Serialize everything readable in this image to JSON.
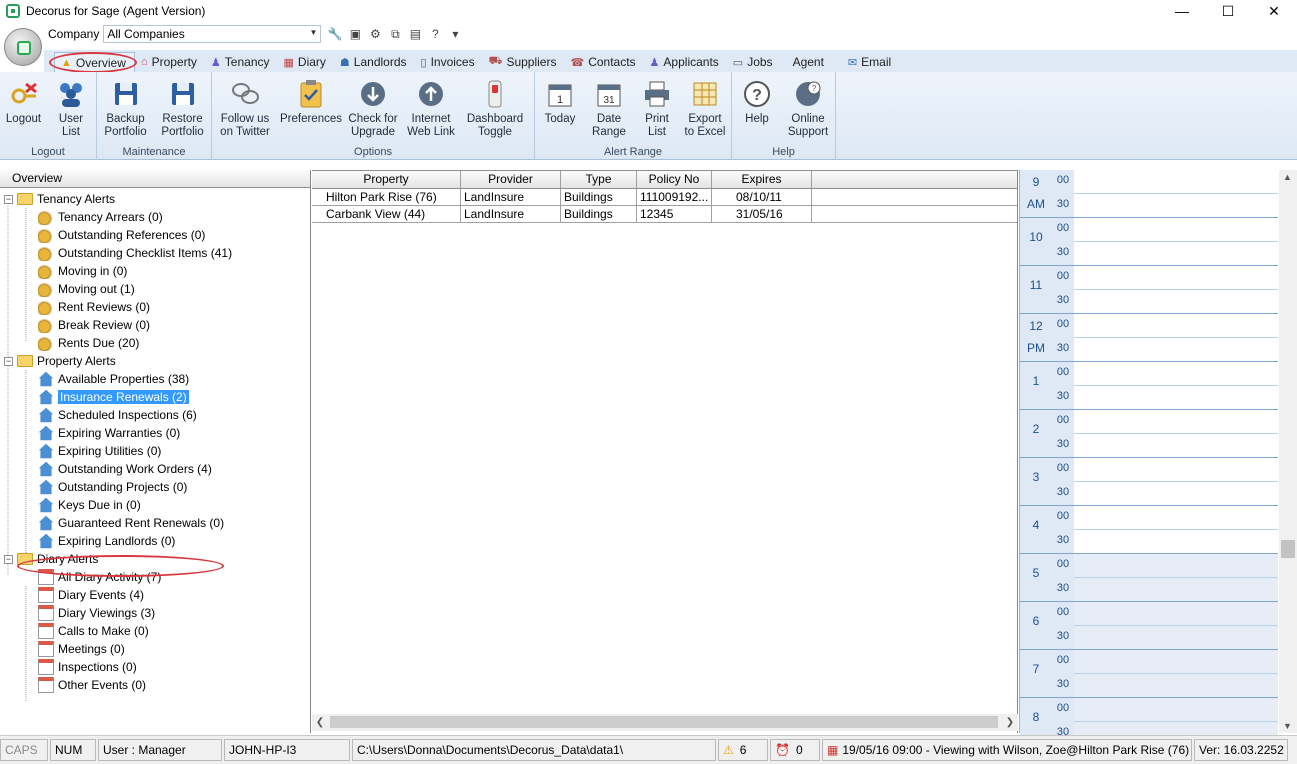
{
  "window": {
    "title": "Decorus for Sage (Agent Version)",
    "minimize": "—",
    "maximize": "☐",
    "close": "✕"
  },
  "company": {
    "label": "Company",
    "value": "All Companies"
  },
  "tabs": [
    {
      "label": "Overview",
      "icon": "overview-icon"
    },
    {
      "label": "Property",
      "icon": "property-icon"
    },
    {
      "label": "Tenancy",
      "icon": "tenancy-icon"
    },
    {
      "label": "Diary",
      "icon": "diary-icon"
    },
    {
      "label": "Landlords",
      "icon": "landlords-icon"
    },
    {
      "label": "Invoices",
      "icon": "invoices-icon"
    },
    {
      "label": "Suppliers",
      "icon": "suppliers-icon"
    },
    {
      "label": "Contacts",
      "icon": "contacts-icon"
    },
    {
      "label": "Applicants",
      "icon": "applicants-icon"
    },
    {
      "label": "Jobs",
      "icon": "jobs-icon"
    },
    {
      "label": "Agent",
      "icon": ""
    },
    {
      "label": "Email",
      "icon": "email-icon"
    }
  ],
  "ribbon": {
    "logout": {
      "group": "Logout",
      "logout": "Logout",
      "user_list_1": "User",
      "user_list_2": "List"
    },
    "maintenance": {
      "group": "Maintenance",
      "backup_1": "Backup",
      "backup_2": "Portfolio",
      "restore_1": "Restore",
      "restore_2": "Portfolio"
    },
    "options": {
      "group": "Options",
      "twitter_1": "Follow us",
      "twitter_2": "on Twitter",
      "preferences": "Preferences",
      "upgrade_1": "Check for",
      "upgrade_2": "Upgrade",
      "weblink_1": "Internet",
      "weblink_2": "Web Link",
      "dash_1": "Dashboard",
      "dash_2": "Toggle"
    },
    "alert_range": {
      "group": "Alert Range",
      "today": "Today",
      "date_1": "Date",
      "date_2": "Range",
      "print_1": "Print",
      "print_2": "List",
      "excel_1": "Export",
      "excel_2": "to Excel"
    },
    "help": {
      "group": "Help",
      "help": "Help",
      "support_1": "Online",
      "support_2": "Support"
    }
  },
  "tree": {
    "header": "Overview",
    "groups": [
      {
        "label": "Tenancy Alerts",
        "items": [
          "Tenancy Arrears (0)",
          "Outstanding References  (0)",
          "Outstanding Checklist Items (41)",
          "Moving in (0)",
          "Moving out (1)",
          "Rent Reviews (0)",
          "Break Review (0)",
          "Rents Due (20)"
        ]
      },
      {
        "label": "Property Alerts",
        "items": [
          "Available Properties (38)",
          "Insurance Renewals (2)",
          "Scheduled Inspections (6)",
          "Expiring Warranties (0)",
          "Expiring Utilities (0)",
          "Outstanding Work Orders (4)",
          "Outstanding Projects (0)",
          "Keys Due in (0)",
          "Guaranteed Rent Renewals (0)",
          "Expiring Landlords (0)"
        ]
      },
      {
        "label": "Diary Alerts",
        "items": [
          "All Diary Activity (7)",
          "Diary Events (4)",
          "Diary Viewings (3)",
          "Calls to Make (0)",
          "Meetings (0)",
          "Inspections (0)",
          "Other Events (0)"
        ]
      }
    ]
  },
  "grid": {
    "columns": [
      "Property",
      "Provider",
      "Type",
      "Policy No",
      "Expires"
    ],
    "rows": [
      [
        "Hilton Park Rise (76)",
        "LandInsure",
        "Buildings",
        "111009192...",
        "08/10/11"
      ],
      [
        "Carbank View (44)",
        "LandInsure",
        "Buildings",
        "12345",
        "31/05/16"
      ]
    ]
  },
  "diary": {
    "hours": [
      {
        "hour": "9",
        "ampm": "AM"
      },
      {
        "hour": "10",
        "ampm": ""
      },
      {
        "hour": "11",
        "ampm": ""
      },
      {
        "hour": "12",
        "ampm": "PM"
      },
      {
        "hour": "1",
        "ampm": ""
      },
      {
        "hour": "2",
        "ampm": ""
      },
      {
        "hour": "3",
        "ampm": ""
      },
      {
        "hour": "4",
        "ampm": ""
      },
      {
        "hour": "5",
        "ampm": ""
      },
      {
        "hour": "6",
        "ampm": ""
      },
      {
        "hour": "7",
        "ampm": ""
      },
      {
        "hour": "8",
        "ampm": ""
      }
    ],
    "min_00": "00",
    "min_30": "30"
  },
  "status": {
    "caps": "CAPS",
    "num": "NUM",
    "user": "User : Manager",
    "machine": "JOHN-HP-I3",
    "path": "C:\\Users\\Donna\\Documents\\Decorus_Data\\data1\\",
    "warnings": "6",
    "alarms": "0",
    "next_event": "19/05/16 09:00 - Viewing with Wilson, Zoe@Hilton Park Rise (76)",
    "version": "Ver: 16.03.2252"
  },
  "colors": {
    "accent_tab": "#dfe9f5",
    "selection": "#3399ff",
    "highlight_ring": "#d9363e"
  }
}
